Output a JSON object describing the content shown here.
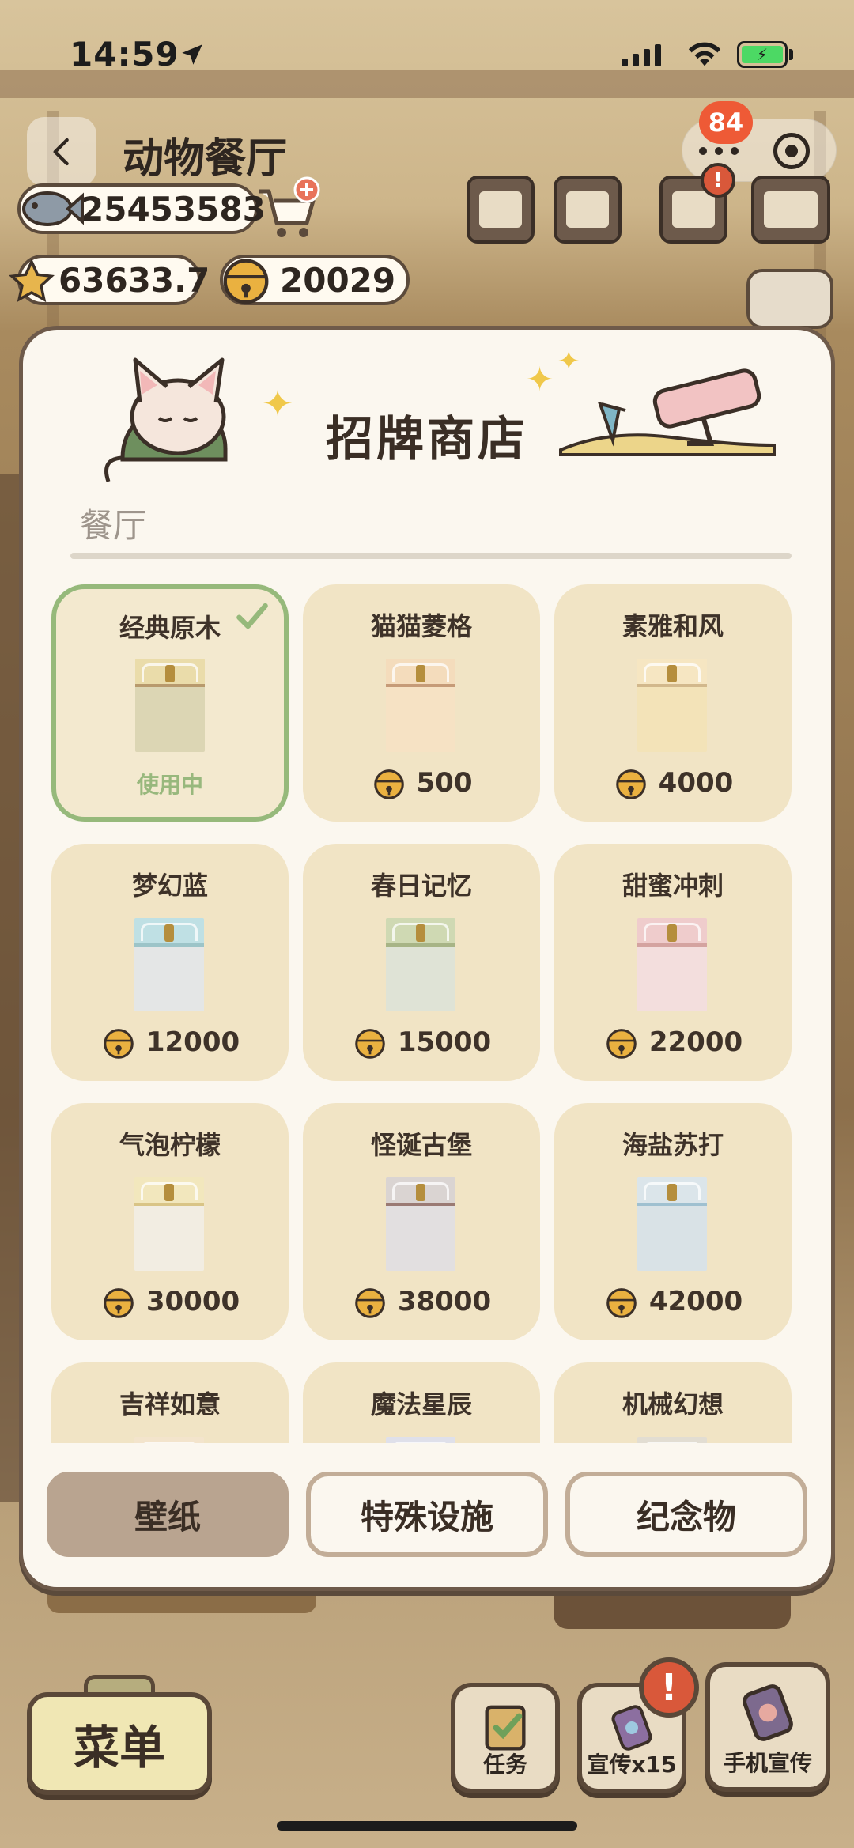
{
  "status_bar": {
    "time": "14:59"
  },
  "header": {
    "title": "动物餐厅",
    "notification_count": "84"
  },
  "currencies": {
    "fish": "25453583",
    "stars": "63633.7",
    "bells": "20029"
  },
  "top_icons": {
    "alert_badge": "!"
  },
  "modal": {
    "title": "招牌商店",
    "section": "餐厅",
    "items": [
      {
        "name": "经典原木",
        "status": "使用中",
        "price": null,
        "wall": "#eadcaa",
        "floor": "#dcd6b4",
        "trim": "#b89a6d"
      },
      {
        "name": "猫猫菱格",
        "price": "500",
        "wall": "#f4dcbc",
        "floor": "#f6e2c4",
        "trim": "#c69b78"
      },
      {
        "name": "素雅和风",
        "price": "4000",
        "wall": "#f6e6c2",
        "floor": "#f3e3b8",
        "trim": "#d2b88c"
      },
      {
        "name": "梦幻蓝",
        "price": "12000",
        "wall": "#bfe0e4",
        "floor": "#e4e6e6",
        "trim": "#9cc4c8"
      },
      {
        "name": "春日记忆",
        "price": "15000",
        "wall": "#cfd9b3",
        "floor": "#dfe3d6",
        "trim": "#a7b486"
      },
      {
        "name": "甜蜜冲刺",
        "price": "22000",
        "wall": "#efcccc",
        "floor": "#f3dedd",
        "trim": "#d4a3a0"
      },
      {
        "name": "气泡柠檬",
        "price": "30000",
        "wall": "#f2e7bd",
        "floor": "#f2ede2",
        "trim": "#d9c486"
      },
      {
        "name": "怪诞古堡",
        "price": "38000",
        "wall": "#dad4d2",
        "floor": "#e2dfe0",
        "trim": "#9a7a74"
      },
      {
        "name": "海盐苏打",
        "price": "42000",
        "wall": "#dbe5ea",
        "floor": "#d9e2e6",
        "trim": "#9fc0d0"
      },
      {
        "name": "吉祥如意",
        "price": "",
        "wall": "#f3e4cc",
        "floor": "#f1e5d0",
        "trim": "#d08a54"
      },
      {
        "name": "魔法星辰",
        "price": "",
        "wall": "#dfe0ea",
        "floor": "#e6e6ec",
        "trim": "#8a93b8"
      },
      {
        "name": "机械幻想",
        "price": "",
        "wall": "#e2ddd2",
        "floor": "#e8e4dc",
        "trim": "#a3a097"
      }
    ],
    "tabs": [
      {
        "label": "壁纸",
        "active": true
      },
      {
        "label": "特殊设施",
        "active": false
      },
      {
        "label": "纪念物",
        "active": false
      }
    ]
  },
  "bottom": {
    "menu_label": "菜单",
    "task_label": "任务",
    "promo_label": "宣传x15",
    "phone_promo_label": "手机宣传",
    "alert": "!"
  },
  "colors": {
    "accent_green": "#96b97b",
    "badge_red": "#ee5a36",
    "card_bg": "#f1e4c5",
    "tab_active": "#b9a490"
  }
}
